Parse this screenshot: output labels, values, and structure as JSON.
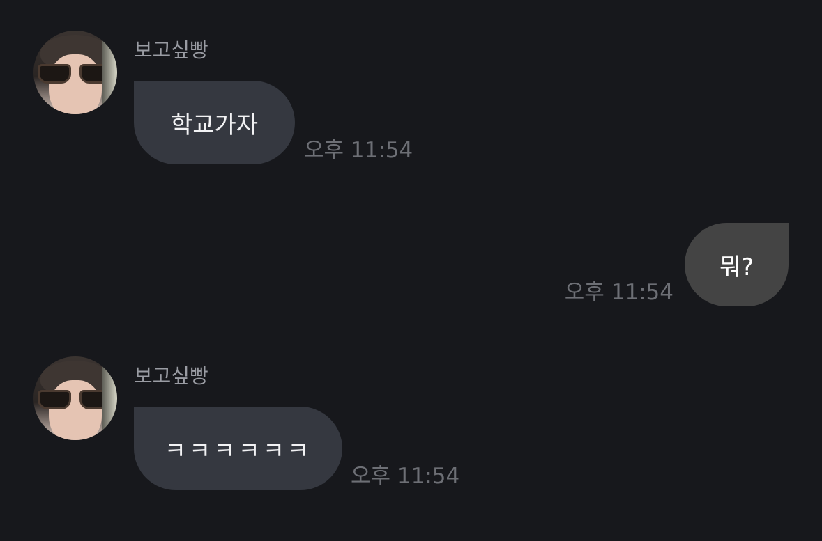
{
  "messages": [
    {
      "direction": "incoming",
      "sender": "보고싶빵",
      "text": "학교가자",
      "time": "오후 11:54"
    },
    {
      "direction": "outgoing",
      "text": "뭐?",
      "time": "오후 11:54"
    },
    {
      "direction": "incoming",
      "sender": "보고싶빵",
      "text": "ㅋㅋㅋㅋㅋㅋ",
      "time": "오후 11:54"
    }
  ],
  "colors": {
    "background": "#17181c",
    "incoming_bubble": "#353840",
    "outgoing_bubble": "#444444",
    "sender_name": "#9a9ca3",
    "timestamp": "#6d6f75"
  }
}
